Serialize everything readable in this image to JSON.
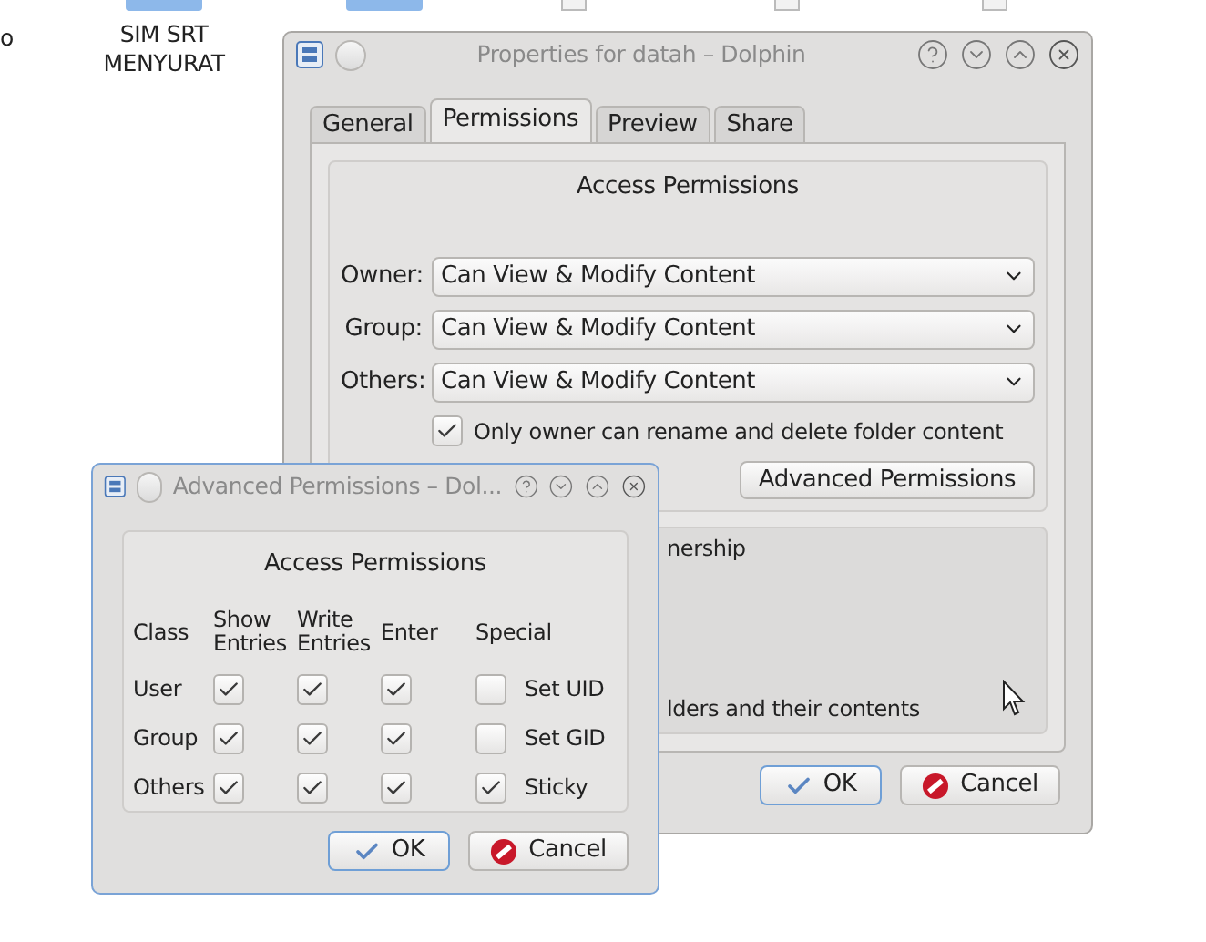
{
  "desktop_icons": [
    {
      "label": "o"
    },
    {
      "label": "SIM SRT MENYURAT"
    }
  ],
  "main_window": {
    "title": "Properties for datah – Dolphin",
    "tabs": [
      {
        "label": "General",
        "selected": false
      },
      {
        "label": "Permissions",
        "selected": true
      },
      {
        "label": "Preview",
        "selected": false
      },
      {
        "label": "Share",
        "selected": false
      }
    ],
    "access_group": {
      "title": "Access Permissions",
      "rows": [
        {
          "label": "Owner:",
          "value": "Can View & Modify Content"
        },
        {
          "label": "Group:",
          "value": "Can View & Modify Content"
        },
        {
          "label": "Others:",
          "value": "Can View & Modify Content"
        }
      ],
      "checkbox": {
        "label": "Only owner can rename and delete folder content",
        "checked": true
      },
      "advanced_button": "Advanced Permissions"
    },
    "ownership_group": {
      "text_1": "nership",
      "text_2": "lders and their contents"
    },
    "buttons": [
      {
        "label": "OK",
        "kind": "ok"
      },
      {
        "label": "Cancel",
        "kind": "cancel"
      }
    ]
  },
  "advanced_dialog": {
    "title": "Advanced Permissions – Dol...",
    "group_title": "Access Permissions",
    "columns": [
      "Class",
      "Show Entries",
      "Write Entries",
      "Enter",
      "Special"
    ],
    "rows": [
      {
        "label": "User",
        "show": true,
        "write": true,
        "enter": true,
        "special": {
          "label": "Set UID",
          "checked": false
        }
      },
      {
        "label": "Group",
        "show": true,
        "write": true,
        "enter": true,
        "special": {
          "label": "Set GID",
          "checked": false
        }
      },
      {
        "label": "Others",
        "show": true,
        "write": true,
        "enter": true,
        "special": {
          "label": "Sticky",
          "checked": true
        }
      }
    ],
    "buttons": [
      {
        "label": "OK",
        "kind": "ok"
      },
      {
        "label": "Cancel",
        "kind": "cancel"
      }
    ]
  }
}
